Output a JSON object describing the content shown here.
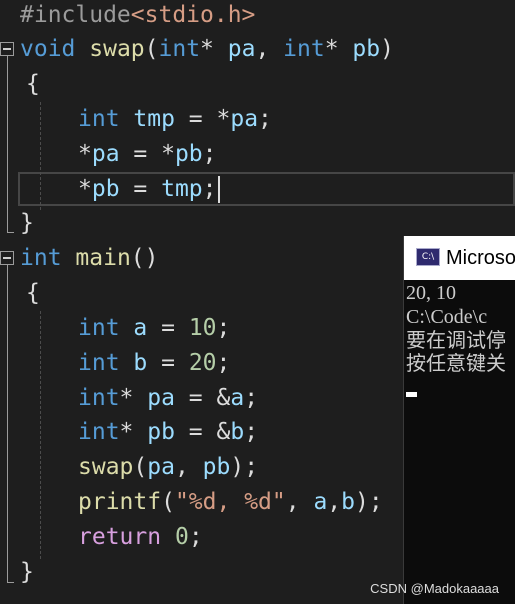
{
  "editor": {
    "lines": [
      {
        "id": "include",
        "tokens": [
          {
            "t": "#include",
            "c": "pre"
          },
          {
            "t": "<stdio.h>",
            "c": "inc"
          }
        ]
      },
      {
        "id": "swap-signature",
        "tokens": [
          {
            "t": "void",
            "c": "kw"
          },
          {
            "t": " ",
            "c": "plain"
          },
          {
            "t": "swap",
            "c": "fn"
          },
          {
            "t": "(",
            "c": "plain"
          },
          {
            "t": "int",
            "c": "kw"
          },
          {
            "t": "* ",
            "c": "plain"
          },
          {
            "t": "pa",
            "c": "var"
          },
          {
            "t": ", ",
            "c": "plain"
          },
          {
            "t": "int",
            "c": "kw"
          },
          {
            "t": "* ",
            "c": "plain"
          },
          {
            "t": "pb",
            "c": "var"
          },
          {
            "t": ")",
            "c": "plain"
          }
        ]
      },
      {
        "id": "swap-open-brace",
        "tokens": [
          {
            "t": "{",
            "c": "plain"
          }
        ]
      },
      {
        "id": "tmp-decl",
        "tokens": [
          {
            "t": "int",
            "c": "kw"
          },
          {
            "t": " ",
            "c": "plain"
          },
          {
            "t": "tmp",
            "c": "var"
          },
          {
            "t": " = *",
            "c": "plain"
          },
          {
            "t": "pa",
            "c": "var"
          },
          {
            "t": ";",
            "c": "plain"
          }
        ]
      },
      {
        "id": "pa-assign",
        "tokens": [
          {
            "t": "*",
            "c": "plain"
          },
          {
            "t": "pa",
            "c": "var"
          },
          {
            "t": " = *",
            "c": "plain"
          },
          {
            "t": "pb",
            "c": "var"
          },
          {
            "t": ";",
            "c": "plain"
          }
        ]
      },
      {
        "id": "pb-assign",
        "tokens": [
          {
            "t": "*",
            "c": "plain"
          },
          {
            "t": "pb",
            "c": "var"
          },
          {
            "t": " = ",
            "c": "plain"
          },
          {
            "t": "tmp",
            "c": "var"
          },
          {
            "t": ";",
            "c": "plain"
          }
        ]
      },
      {
        "id": "swap-close-brace",
        "tokens": [
          {
            "t": "}",
            "c": "plain"
          }
        ]
      },
      {
        "id": "main-signature",
        "tokens": [
          {
            "t": "int",
            "c": "kw"
          },
          {
            "t": " ",
            "c": "plain"
          },
          {
            "t": "main",
            "c": "fn"
          },
          {
            "t": "()",
            "c": "plain"
          }
        ]
      },
      {
        "id": "main-open-brace",
        "tokens": [
          {
            "t": "{",
            "c": "plain"
          }
        ]
      },
      {
        "id": "a-decl",
        "tokens": [
          {
            "t": "int",
            "c": "kw"
          },
          {
            "t": " ",
            "c": "plain"
          },
          {
            "t": "a",
            "c": "var"
          },
          {
            "t": " = ",
            "c": "plain"
          },
          {
            "t": "10",
            "c": "num"
          },
          {
            "t": ";",
            "c": "plain"
          }
        ]
      },
      {
        "id": "b-decl",
        "tokens": [
          {
            "t": "int",
            "c": "kw"
          },
          {
            "t": " ",
            "c": "plain"
          },
          {
            "t": "b",
            "c": "var"
          },
          {
            "t": " = ",
            "c": "plain"
          },
          {
            "t": "20",
            "c": "num"
          },
          {
            "t": ";",
            "c": "plain"
          }
        ]
      },
      {
        "id": "pa-decl",
        "tokens": [
          {
            "t": "int",
            "c": "kw"
          },
          {
            "t": "* ",
            "c": "plain"
          },
          {
            "t": "pa",
            "c": "var"
          },
          {
            "t": " = &",
            "c": "plain"
          },
          {
            "t": "a",
            "c": "var"
          },
          {
            "t": ";",
            "c": "plain"
          }
        ]
      },
      {
        "id": "pb-decl",
        "tokens": [
          {
            "t": "int",
            "c": "kw"
          },
          {
            "t": "* ",
            "c": "plain"
          },
          {
            "t": "pb",
            "c": "var"
          },
          {
            "t": " = &",
            "c": "plain"
          },
          {
            "t": "b",
            "c": "var"
          },
          {
            "t": ";",
            "c": "plain"
          }
        ]
      },
      {
        "id": "swap-call",
        "tokens": [
          {
            "t": "swap",
            "c": "fn"
          },
          {
            "t": "(",
            "c": "plain"
          },
          {
            "t": "pa",
            "c": "var"
          },
          {
            "t": ", ",
            "c": "plain"
          },
          {
            "t": "pb",
            "c": "var"
          },
          {
            "t": ");",
            "c": "plain"
          }
        ]
      },
      {
        "id": "printf-call",
        "tokens": [
          {
            "t": "printf",
            "c": "fn"
          },
          {
            "t": "(",
            "c": "plain"
          },
          {
            "t": "\"%d, %d\"",
            "c": "str"
          },
          {
            "t": ", ",
            "c": "plain"
          },
          {
            "t": "a",
            "c": "var"
          },
          {
            "t": ",",
            "c": "plain"
          },
          {
            "t": "b",
            "c": "var"
          },
          {
            "t": ");",
            "c": "plain"
          }
        ]
      },
      {
        "id": "return-stmt",
        "tokens": [
          {
            "t": "return",
            "c": "ctl"
          },
          {
            "t": " ",
            "c": "plain"
          },
          {
            "t": "0",
            "c": "num"
          },
          {
            "t": ";",
            "c": "plain"
          }
        ]
      },
      {
        "id": "main-close-brace",
        "tokens": [
          {
            "t": "}",
            "c": "plain"
          }
        ]
      }
    ]
  },
  "console": {
    "title": "Microsoft Visual Studio 调试控制台",
    "icon_text": "C:\\",
    "output": [
      "20, 10",
      "C:\\Code\\c",
      "要在调试停",
      "按任意键关"
    ]
  },
  "watermark": "CSDN @Madokaaaaa",
  "colors": {
    "background": "#1e1e1e",
    "keyword": "#569cd6",
    "function": "#dcdcaa",
    "variable": "#9cdcfe",
    "number": "#b5cea8",
    "string": "#d69d85",
    "control": "#d8a0df",
    "console_bg": "#0c0c0c"
  }
}
